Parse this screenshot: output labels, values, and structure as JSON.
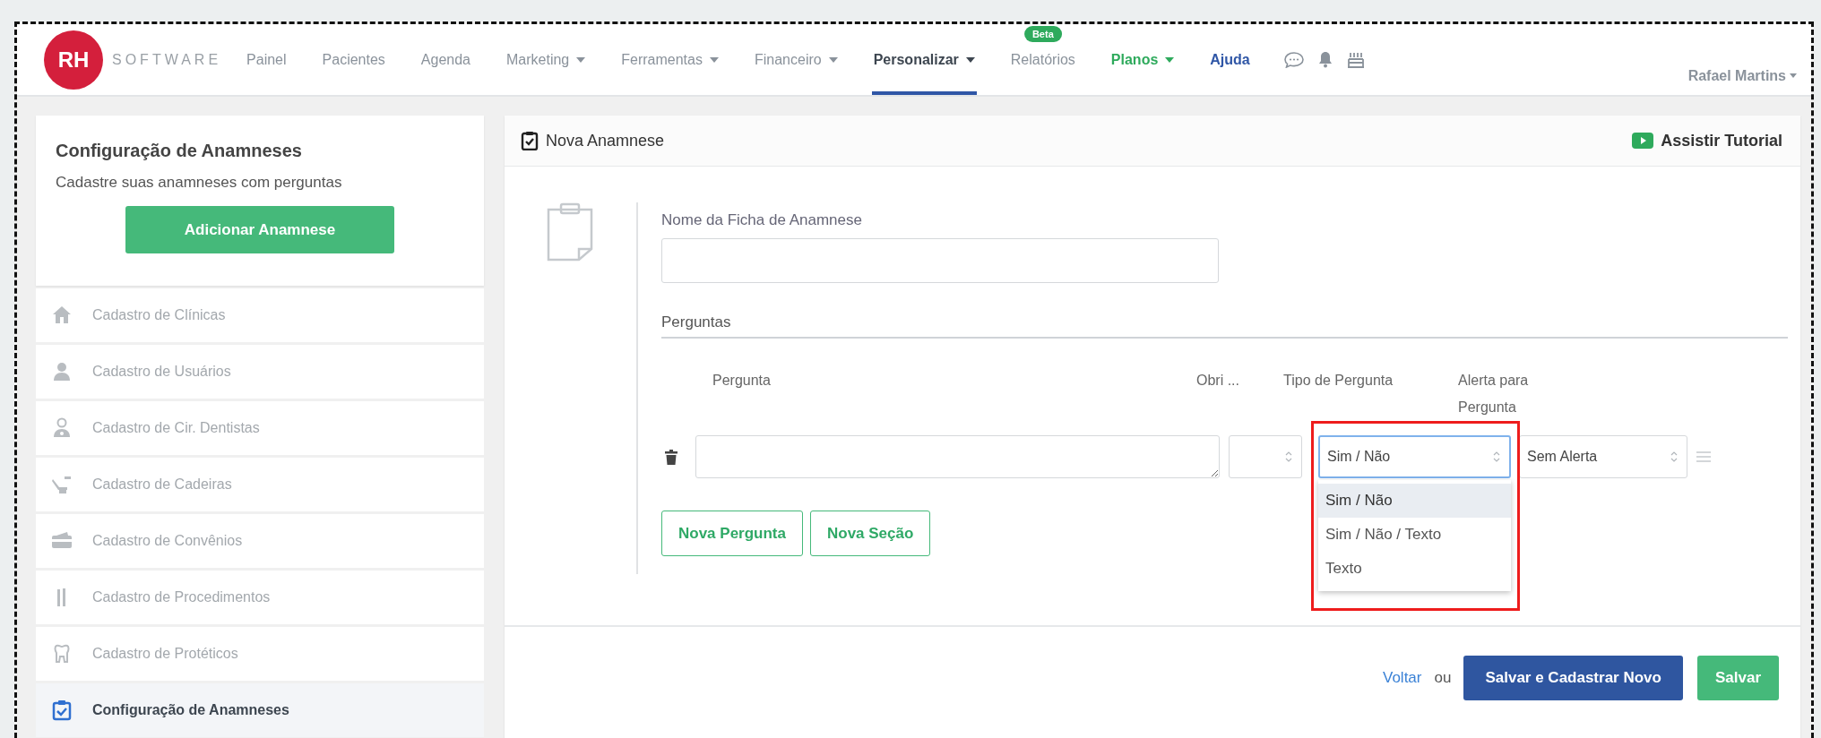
{
  "nav": {
    "logo": "RH",
    "brand": "SOFTWARE",
    "items": [
      {
        "label": "Painel",
        "kind": "plain",
        "dropdown": false,
        "selected": false
      },
      {
        "label": "Pacientes",
        "kind": "plain",
        "dropdown": false,
        "selected": false
      },
      {
        "label": "Agenda",
        "kind": "plain",
        "dropdown": false,
        "selected": false
      },
      {
        "label": "Marketing",
        "kind": "plain",
        "dropdown": true,
        "selected": false
      },
      {
        "label": "Ferramentas",
        "kind": "plain",
        "dropdown": true,
        "selected": false
      },
      {
        "label": "Financeiro",
        "kind": "plain",
        "dropdown": true,
        "selected": false
      },
      {
        "label": "Personalizar",
        "kind": "plain",
        "dropdown": true,
        "selected": true
      },
      {
        "label": "Relatórios",
        "kind": "plain",
        "dropdown": false,
        "selected": false,
        "badge": "Beta"
      },
      {
        "label": "Planos",
        "kind": "promo",
        "dropdown": true,
        "selected": false
      },
      {
        "label": "Ajuda",
        "kind": "help",
        "dropdown": false,
        "selected": false
      }
    ],
    "user": "Rafael Martins"
  },
  "sidebar": {
    "title": "Configuração de Anamneses",
    "description": "Cadastre suas anamneses com perguntas",
    "add_button": "Adicionar Anamnese",
    "items": [
      {
        "label": "Cadastro de Clínicas",
        "kind": "house",
        "selected": false
      },
      {
        "label": "Cadastro de Usuários",
        "kind": "user",
        "selected": false
      },
      {
        "label": "Cadastro de Cir. Dentistas",
        "kind": "doctor",
        "selected": false
      },
      {
        "label": "Cadastro de Cadeiras",
        "kind": "chair",
        "selected": false
      },
      {
        "label": "Cadastro de Convênios",
        "kind": "card",
        "selected": false
      },
      {
        "label": "Cadastro de Procedimentos",
        "kind": "tools",
        "selected": false
      },
      {
        "label": "Cadastro de Protéticos",
        "kind": "tooth",
        "selected": false
      },
      {
        "label": "Configuração de Anamneses",
        "kind": "clipboard",
        "selected": true
      }
    ]
  },
  "form": {
    "title": "Nova Anamnese",
    "tutorial_link": "Assistir Tutorial",
    "name_label": "Nome da Ficha de Anamnese",
    "section_title": "Perguntas",
    "columns": [
      "Pergunta",
      "Obri ...",
      "Tipo de Pergunta",
      "Alerta para Pergunta"
    ],
    "row": {
      "type_value": "Sim / Não",
      "alert_value": "Sem Alerta"
    },
    "type_dropdown": {
      "expanded": true,
      "options": [
        {
          "label": "Sim / Não",
          "selected": true
        },
        {
          "label": "Sim / Não / Texto",
          "selected": false
        },
        {
          "label": "Texto",
          "selected": false
        }
      ]
    },
    "add_buttons": [
      "Nova Pergunta",
      "Nova Seção"
    ],
    "footer": {
      "back_link": "Voltar",
      "or_text": "ou",
      "save_new_button": "Salvar e Cadastrar Novo",
      "save_button": "Salvar"
    }
  }
}
